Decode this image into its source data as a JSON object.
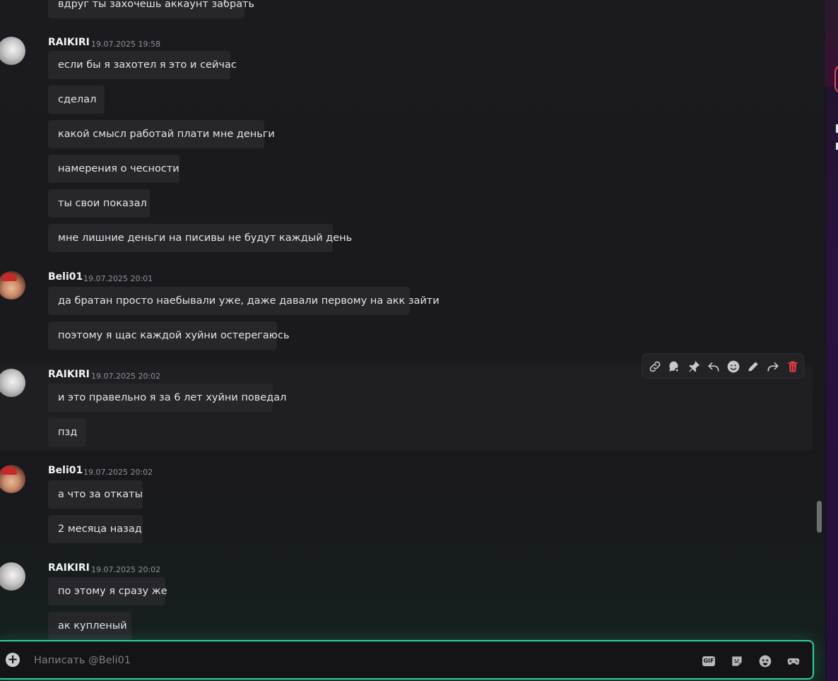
{
  "messages": [
    {
      "author": "",
      "timestamp": "",
      "lines": [
        "вдруг ты захочешь аккаунт забрать"
      ]
    },
    {
      "author": "RAIKIRI",
      "timestamp": "19.07.2025 19:58",
      "lines": [
        "если бы я захотел я это и сейчас",
        "сделал",
        "какой смысл работай плати мне деньги",
        "намерения о чесности",
        "ты свои показал",
        "мне лишние деньги на писивы не будут каждый день"
      ]
    },
    {
      "author": "Beli01",
      "timestamp": "19.07.2025 20:01",
      "lines": [
        "да братан просто наебывали уже, даже давали первому на акк зайти",
        "поэтому я щас каждой хуйни остерегаюсь"
      ]
    },
    {
      "author": "RAIKIRI",
      "timestamp": "19.07.2025 20:02",
      "lines": [
        "и это правельно я за 6 лет хуйни поведал",
        "пзд"
      ]
    },
    {
      "author": "Beli01",
      "timestamp": "19.07.2025 20:02",
      "lines": [
        "а что за откаты",
        "2 месяца назад"
      ]
    },
    {
      "author": "RAIKIRI",
      "timestamp": "19.07.2025 20:02",
      "lines": [
        "по этому я сразу же",
        "ак купленый"
      ]
    }
  ],
  "toolbar": {
    "icons": [
      "link-icon",
      "thread-icon",
      "pin-icon",
      "reply-icon",
      "emoji-icon",
      "edit-icon",
      "forward-icon",
      "delete-icon"
    ]
  },
  "composer": {
    "placeholder": "Написать @Beli01",
    "gif_label": "GIF",
    "icons": [
      "add-icon",
      "gif-icon",
      "sticker-icon",
      "emoji-icon",
      "game-icon"
    ]
  },
  "colors": {
    "accent": "#2fd0a0",
    "danger": "#f23f43",
    "bubble": "#26262b"
  }
}
